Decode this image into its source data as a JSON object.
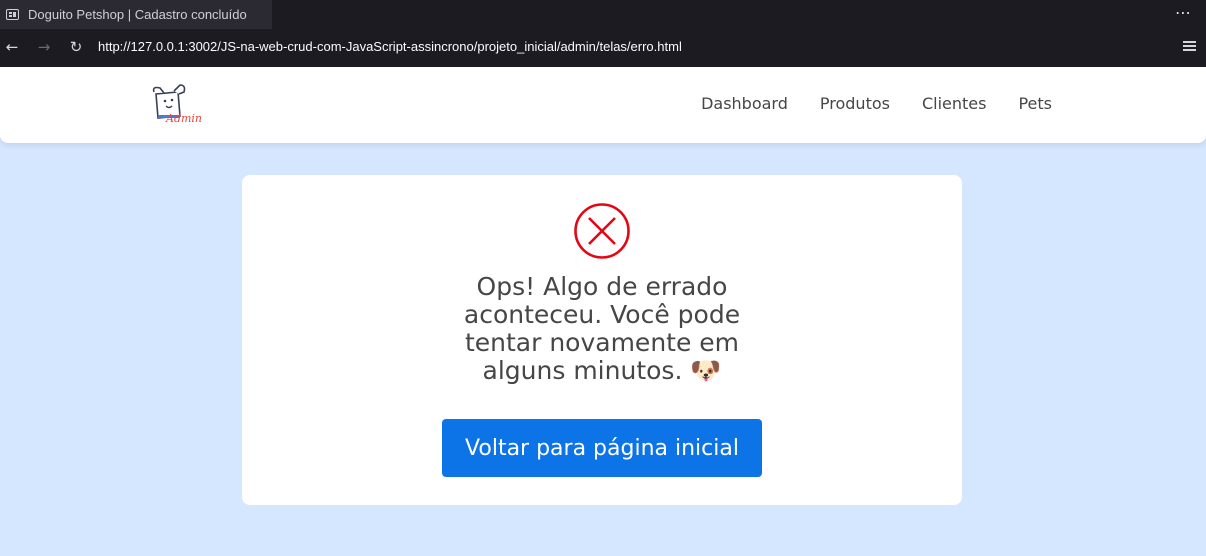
{
  "browser": {
    "tab_title": "Doguito Petshop | Cadastro concluído",
    "tab_menu": "⋯",
    "url": "http://127.0.0.1:3002/JS-na-web-crud-com-JavaScript-assincrono/projeto_inicial/admin/telas/erro.html",
    "back_icon": "←",
    "forward_icon": "→",
    "reload_icon": "↻"
  },
  "header": {
    "logo_text": "Admin",
    "menu": [
      {
        "label": "Dashboard"
      },
      {
        "label": "Produtos"
      },
      {
        "label": "Clientes"
      },
      {
        "label": "Pets"
      }
    ]
  },
  "card": {
    "icon": "error-x-circle-icon",
    "message": "Ops! Algo de errado aconteceu. Você pode tentar novamente em alguns minutos. 🐶",
    "button_label": "Voltar para página inicial"
  },
  "colors": {
    "page_background": "#d5e7ff",
    "error_red": "#e30613",
    "button_blue": "#0d74e7",
    "text": "#464646",
    "logo_accent": "#e8463c"
  }
}
